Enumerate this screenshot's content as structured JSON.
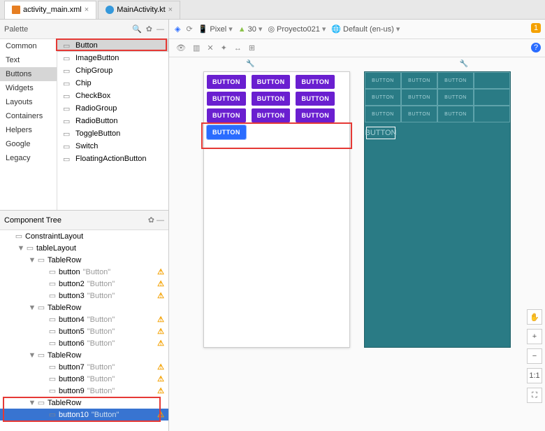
{
  "tabs": [
    {
      "label": "activity_main.xml",
      "active": true,
      "icon_color": "#e67e22"
    },
    {
      "label": "MainActivity.kt",
      "active": false,
      "icon_color": "#3498db"
    }
  ],
  "palette": {
    "title": "Palette",
    "categories": [
      "Common",
      "Text",
      "Buttons",
      "Widgets",
      "Layouts",
      "Containers",
      "Helpers",
      "Google",
      "Legacy"
    ],
    "selected_category": "Buttons",
    "items": [
      "Button",
      "ImageButton",
      "ChipGroup",
      "Chip",
      "CheckBox",
      "RadioGroup",
      "RadioButton",
      "ToggleButton",
      "Switch",
      "FloatingActionButton"
    ],
    "selected_item": "Button"
  },
  "component_tree": {
    "title": "Component Tree",
    "nodes": [
      {
        "depth": 0,
        "arrow": "",
        "label": "ConstraintLayout",
        "sub": "",
        "warn": false,
        "sel": false
      },
      {
        "depth": 1,
        "arrow": "▼",
        "label": "tableLayout",
        "sub": "",
        "warn": false,
        "sel": false
      },
      {
        "depth": 2,
        "arrow": "▼",
        "label": "TableRow",
        "sub": "",
        "warn": false,
        "sel": false
      },
      {
        "depth": 3,
        "arrow": "",
        "label": "button",
        "sub": "\"Button\"",
        "warn": true,
        "sel": false
      },
      {
        "depth": 3,
        "arrow": "",
        "label": "button2",
        "sub": "\"Button\"",
        "warn": true,
        "sel": false
      },
      {
        "depth": 3,
        "arrow": "",
        "label": "button3",
        "sub": "\"Button\"",
        "warn": true,
        "sel": false
      },
      {
        "depth": 2,
        "arrow": "▼",
        "label": "TableRow",
        "sub": "",
        "warn": false,
        "sel": false
      },
      {
        "depth": 3,
        "arrow": "",
        "label": "button4",
        "sub": "\"Button\"",
        "warn": true,
        "sel": false
      },
      {
        "depth": 3,
        "arrow": "",
        "label": "button5",
        "sub": "\"Button\"",
        "warn": true,
        "sel": false
      },
      {
        "depth": 3,
        "arrow": "",
        "label": "button6",
        "sub": "\"Button\"",
        "warn": true,
        "sel": false
      },
      {
        "depth": 2,
        "arrow": "▼",
        "label": "TableRow",
        "sub": "",
        "warn": false,
        "sel": false
      },
      {
        "depth": 3,
        "arrow": "",
        "label": "button7",
        "sub": "\"Button\"",
        "warn": true,
        "sel": false
      },
      {
        "depth": 3,
        "arrow": "",
        "label": "button8",
        "sub": "\"Button\"",
        "warn": true,
        "sel": false
      },
      {
        "depth": 3,
        "arrow": "",
        "label": "button9",
        "sub": "\"Button\"",
        "warn": true,
        "sel": false
      },
      {
        "depth": 2,
        "arrow": "▼",
        "label": "TableRow",
        "sub": "",
        "warn": false,
        "sel": false
      },
      {
        "depth": 3,
        "arrow": "",
        "label": "button10",
        "sub": "\"Button\"",
        "warn": true,
        "sel": true
      }
    ]
  },
  "toolbar": {
    "device": "Pixel",
    "api": "30",
    "project": "Proyecto021",
    "locale": "Default (en-us)"
  },
  "design": {
    "button_label": "BUTTON",
    "rows": 3,
    "cols": 3
  },
  "toolbar_warning_count": "1",
  "info_badge": "?",
  "side_tools": {
    "pan": "✋",
    "plus": "+",
    "minus": "−",
    "fit": "1:1",
    "expand": "⛶"
  }
}
